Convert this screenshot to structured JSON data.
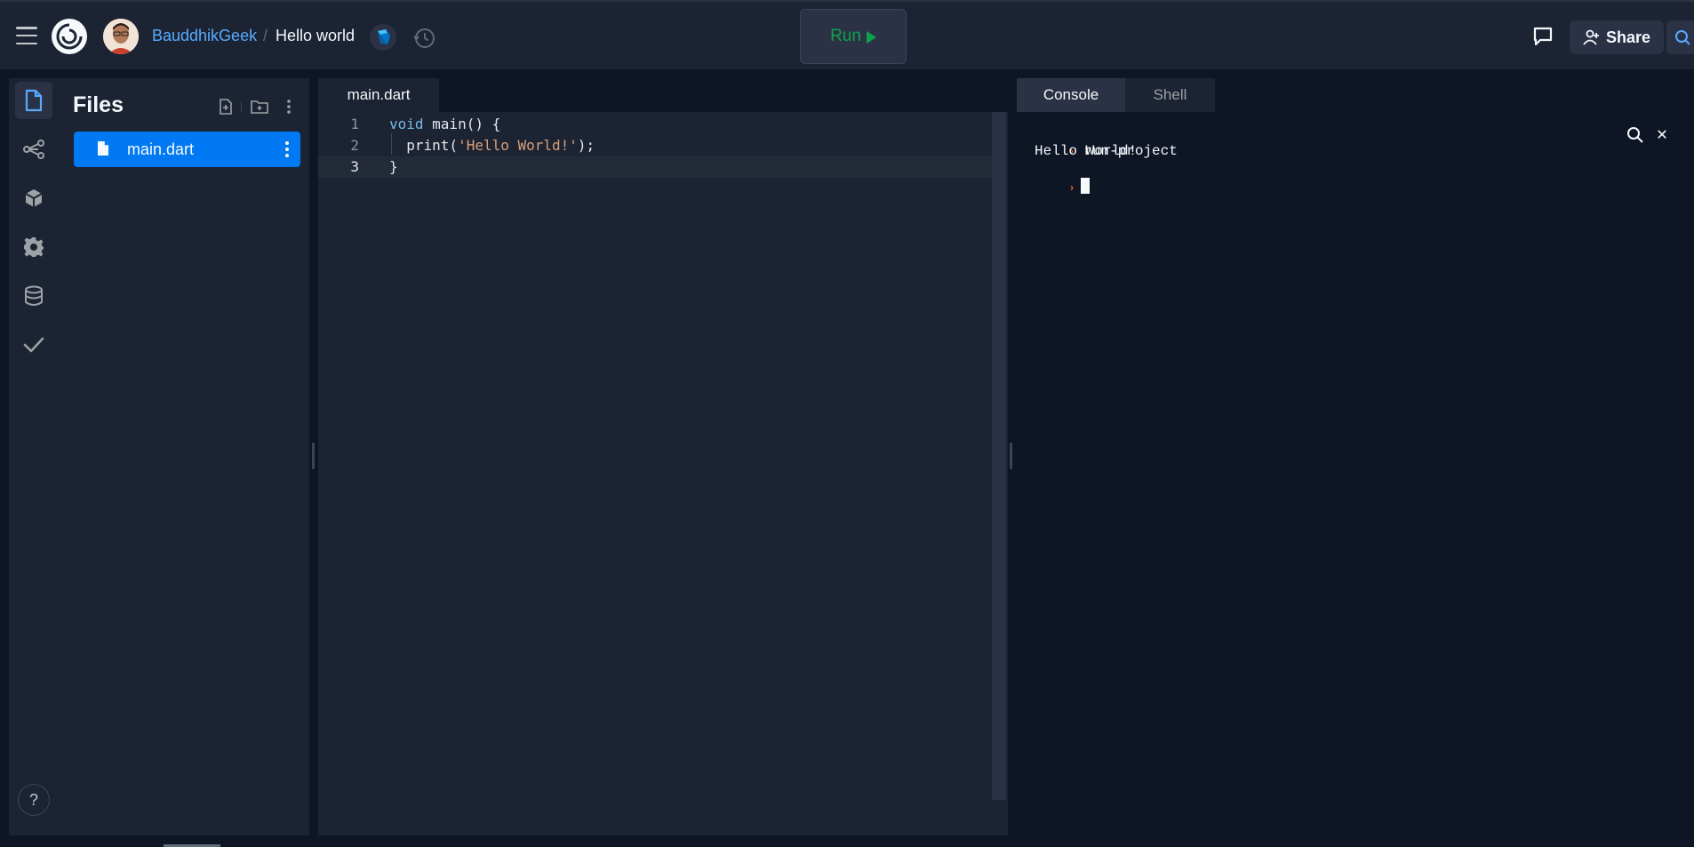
{
  "header": {
    "owner": "BauddhikGeek",
    "separator": "/",
    "repl_name": "Hello world",
    "run_label": "Run",
    "share_label": "Share"
  },
  "rail": {
    "items": [
      "file-icon",
      "git-branch-icon",
      "package-icon",
      "gear-icon",
      "database-icon",
      "checkmark-icon"
    ],
    "help_label": "?"
  },
  "files": {
    "title": "Files",
    "items": [
      {
        "name": "main.dart"
      }
    ]
  },
  "editor": {
    "tab_label": "main.dart",
    "lines": [
      {
        "num": "1",
        "kw": "void",
        "rest": " main() {"
      },
      {
        "num": "2",
        "pre": "  print(",
        "str": "'Hello World!'",
        "post": ");"
      },
      {
        "num": "3",
        "text": "}"
      }
    ]
  },
  "console": {
    "tabs": [
      "Console",
      "Shell"
    ],
    "lines": [
      "run-project",
      "Hello World!"
    ]
  },
  "colors": {
    "accent": "#0079f2",
    "run_green": "#0ea34a",
    "prompt_orange": "#f26522",
    "link_blue": "#57abff"
  }
}
